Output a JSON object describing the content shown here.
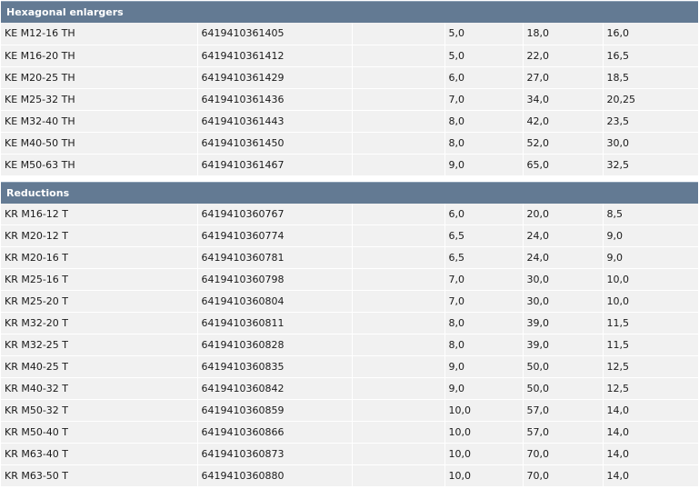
{
  "sections": [
    {
      "title": "Hexagonal enlargers",
      "rows": [
        [
          "KE M12-16 TH",
          "6419410361405",
          "",
          "5,0",
          "18,0",
          "16,0"
        ],
        [
          "KE M16-20 TH",
          "6419410361412",
          "",
          "5,0",
          "22,0",
          "16,5"
        ],
        [
          "KE M20-25 TH",
          "6419410361429",
          "",
          "6,0",
          "27,0",
          "18,5"
        ],
        [
          "KE M25-32 TH",
          "6419410361436",
          "",
          "7,0",
          "34,0",
          "20,25"
        ],
        [
          "KE M32-40 TH",
          "6419410361443",
          "",
          "8,0",
          "42,0",
          "23,5"
        ],
        [
          "KE M40-50 TH",
          "6419410361450",
          "",
          "8,0",
          "52,0",
          "30,0"
        ],
        [
          "KE M50-63 TH",
          "6419410361467",
          "",
          "9,0",
          "65,0",
          "32,5"
        ]
      ]
    },
    {
      "title": "Reductions",
      "rows": [
        [
          "KR M16-12 T",
          "6419410360767",
          "",
          "6,0",
          "20,0",
          "8,5"
        ],
        [
          "KR M20-12 T",
          "6419410360774",
          "",
          "6,5",
          "24,0",
          "9,0"
        ],
        [
          "KR M20-16 T",
          "6419410360781",
          "",
          "6,5",
          "24,0",
          "9,0"
        ],
        [
          "KR M25-16 T",
          "6419410360798",
          "",
          "7,0",
          "30,0",
          "10,0"
        ],
        [
          "KR M25-20 T",
          "6419410360804",
          "",
          "7,0",
          "30,0",
          "10,0"
        ],
        [
          "KR M32-20 T",
          "6419410360811",
          "",
          "8,0",
          "39,0",
          "11,5"
        ],
        [
          "KR M32-25 T",
          "6419410360828",
          "",
          "8,0",
          "39,0",
          "11,5"
        ],
        [
          "KR M40-25 T",
          "6419410360835",
          "",
          "9,0",
          "50,0",
          "12,5"
        ],
        [
          "KR M40-32 T",
          "6419410360842",
          "",
          "9,0",
          "50,0",
          "12,5"
        ],
        [
          "KR M50-32 T",
          "6419410360859",
          "",
          "10,0",
          "57,0",
          "14,0"
        ],
        [
          "KR M50-40 T",
          "6419410360866",
          "",
          "10,0",
          "57,0",
          "14,0"
        ],
        [
          "KR M63-40 T",
          "6419410360873",
          "",
          "10,0",
          "70,0",
          "14,0"
        ],
        [
          "KR M63-50 T",
          "6419410360880",
          "",
          "10,0",
          "70,0",
          "14,0"
        ]
      ]
    }
  ]
}
